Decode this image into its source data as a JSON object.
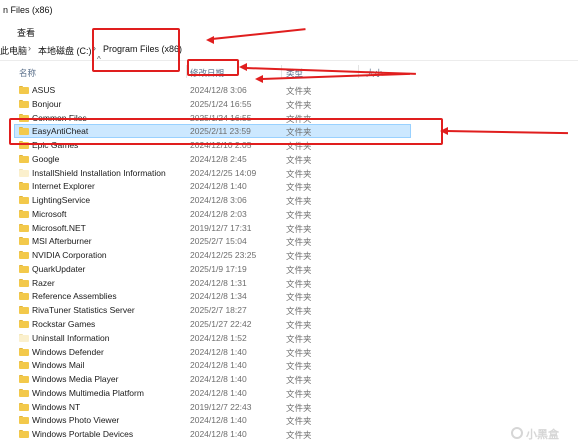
{
  "window": {
    "title": "n Files (x86)"
  },
  "ribbon": {
    "view_tab": "查看"
  },
  "address": {
    "crumbs": [
      "此电脑",
      "本地磁盘 (C:)",
      "Program Files (x86)"
    ],
    "separator": "›"
  },
  "list": {
    "sort_indicator": "^",
    "columns": {
      "name": "名称",
      "date": "修改日期",
      "type": "类型",
      "size": "大小"
    },
    "rows": [
      {
        "name": "ASUS",
        "date": "2024/12/8 3:06",
        "type": "文件夹",
        "icon": "folder-icon"
      },
      {
        "name": "Bonjour",
        "date": "2025/1/24 16:55",
        "type": "文件夹",
        "icon": "folder-icon"
      },
      {
        "name": "Common Files",
        "date": "2025/1/24 16:55",
        "type": "文件夹",
        "icon": "folder-icon"
      },
      {
        "name": "EasyAntiCheat",
        "date": "2025/2/11 23:59",
        "type": "文件夹",
        "icon": "folder-icon",
        "selected": true
      },
      {
        "name": "Epic Games",
        "date": "2024/12/10 2:05",
        "type": "文件夹",
        "icon": "folder-icon"
      },
      {
        "name": "Google",
        "date": "2024/12/8 2:45",
        "type": "文件夹",
        "icon": "folder-icon"
      },
      {
        "name": "InstallShield Installation Information",
        "date": "2024/12/25 14:09",
        "type": "文件夹",
        "icon": "folder-icon-light"
      },
      {
        "name": "Internet Explorer",
        "date": "2024/12/8 1:40",
        "type": "文件夹",
        "icon": "folder-icon"
      },
      {
        "name": "LightingService",
        "date": "2024/12/8 3:06",
        "type": "文件夹",
        "icon": "folder-icon"
      },
      {
        "name": "Microsoft",
        "date": "2024/12/8 2:03",
        "type": "文件夹",
        "icon": "folder-icon"
      },
      {
        "name": "Microsoft.NET",
        "date": "2019/12/7 17:31",
        "type": "文件夹",
        "icon": "folder-icon"
      },
      {
        "name": "MSI Afterburner",
        "date": "2025/2/7 15:04",
        "type": "文件夹",
        "icon": "folder-icon"
      },
      {
        "name": "NVIDIA Corporation",
        "date": "2024/12/25 23:25",
        "type": "文件夹",
        "icon": "folder-icon"
      },
      {
        "name": "QuarkUpdater",
        "date": "2025/1/9 17:19",
        "type": "文件夹",
        "icon": "folder-icon"
      },
      {
        "name": "Razer",
        "date": "2024/12/8 1:31",
        "type": "文件夹",
        "icon": "folder-icon"
      },
      {
        "name": "Reference Assemblies",
        "date": "2024/12/8 1:34",
        "type": "文件夹",
        "icon": "folder-icon"
      },
      {
        "name": "RivaTuner Statistics Server",
        "date": "2025/2/7 18:27",
        "type": "文件夹",
        "icon": "folder-icon"
      },
      {
        "name": "Rockstar Games",
        "date": "2025/1/27 22:42",
        "type": "文件夹",
        "icon": "folder-icon"
      },
      {
        "name": "Uninstall Information",
        "date": "2024/12/8 1:52",
        "type": "文件夹",
        "icon": "folder-icon-light"
      },
      {
        "name": "Windows Defender",
        "date": "2024/12/8 1:40",
        "type": "文件夹",
        "icon": "folder-icon"
      },
      {
        "name": "Windows Mail",
        "date": "2024/12/8 1:40",
        "type": "文件夹",
        "icon": "folder-icon"
      },
      {
        "name": "Windows Media Player",
        "date": "2024/12/8 1:40",
        "type": "文件夹",
        "icon": "folder-icon"
      },
      {
        "name": "Windows Multimedia Platform",
        "date": "2024/12/8 1:40",
        "type": "文件夹",
        "icon": "folder-icon"
      },
      {
        "name": "Windows NT",
        "date": "2019/12/7 22:43",
        "type": "文件夹",
        "icon": "folder-icon"
      },
      {
        "name": "Windows Photo Viewer",
        "date": "2024/12/8 1:40",
        "type": "文件夹",
        "icon": "folder-icon"
      },
      {
        "name": "Windows Portable Devices",
        "date": "2024/12/8 1:40",
        "type": "文件夹",
        "icon": "folder-icon"
      }
    ]
  },
  "annotations": {
    "color": "#e01e1e"
  },
  "watermark": {
    "text": "小黑盒",
    "icon": "watermark-logo-icon"
  }
}
